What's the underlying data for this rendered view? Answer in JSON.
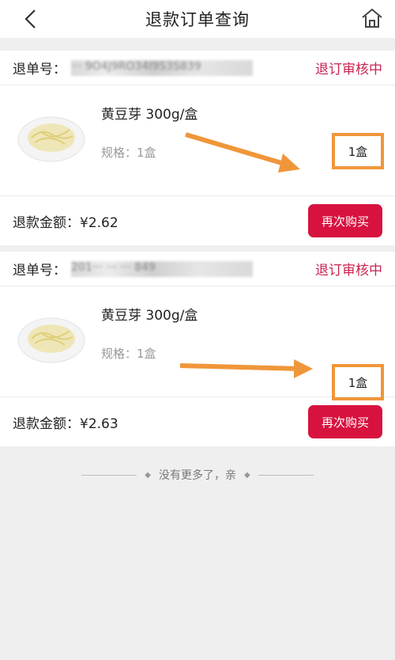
{
  "header": {
    "title": "退款订单查询",
    "back_icon": "chevron-left-icon",
    "home_icon": "home-icon"
  },
  "orders": [
    {
      "order_label": "退单号：",
      "order_number": "··· 9O4J9RO34I9S3S839",
      "status": "退订审核中",
      "product_name": "黄豆芽 300g/盒",
      "spec": "规格：1盒",
      "quantity": "1盒",
      "amount_label": "退款金额：¥2.62",
      "rebuy_label": "再次购买"
    },
    {
      "order_label": "退单号：",
      "order_number": "201··· ··· ··· 849",
      "status": "退订审核中",
      "product_name": "黄豆芽 300g/盒",
      "spec": "规格：1盒",
      "quantity": "1盒",
      "amount_label": "退款金额：¥2.63",
      "rebuy_label": "再次购买"
    }
  ],
  "footer": {
    "no_more": "没有更多了，亲"
  },
  "colors": {
    "accent": "#d8123f",
    "status": "#c8234f",
    "highlight": "#f0963a"
  }
}
